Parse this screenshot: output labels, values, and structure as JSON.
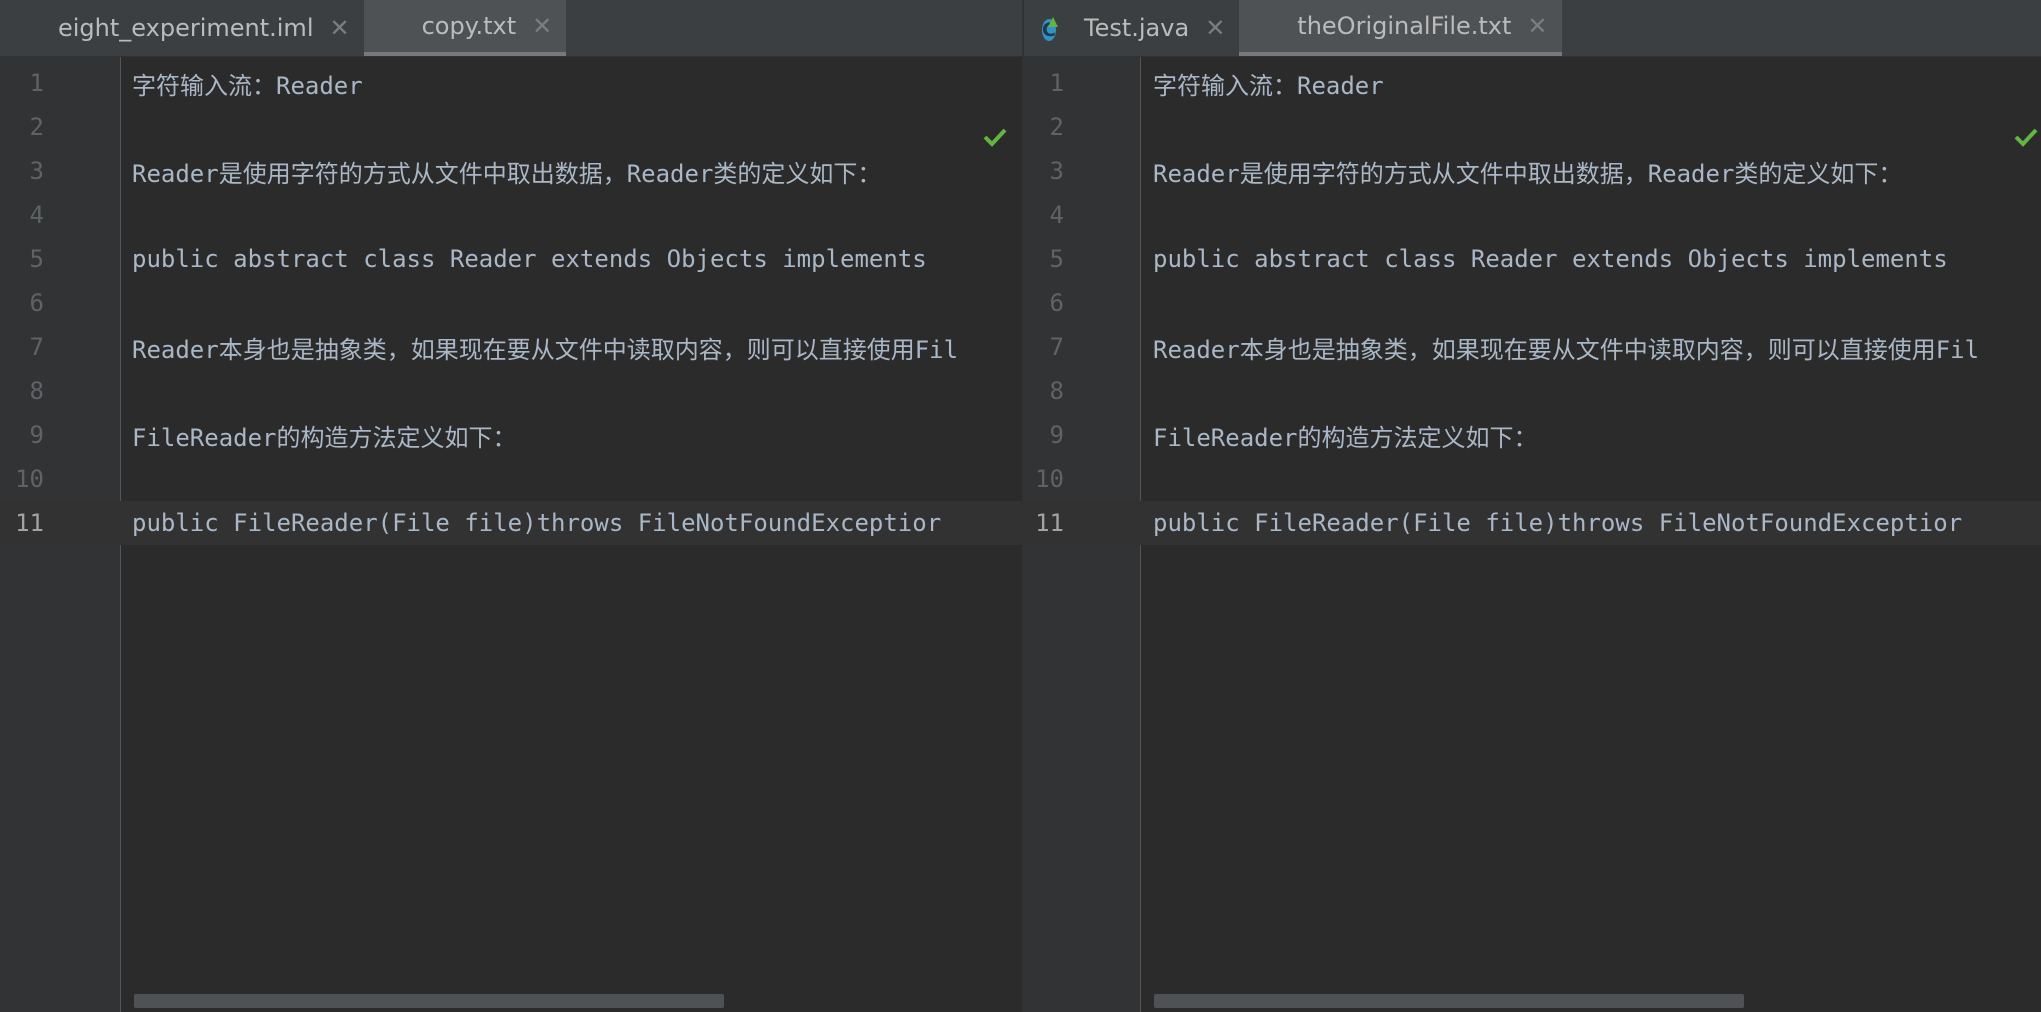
{
  "left_pane": {
    "tabs": [
      {
        "label": "eight_experiment.iml",
        "icon": "module-file-icon",
        "active": false
      },
      {
        "label": "copy.txt",
        "icon": "text-file-icon",
        "active": true
      }
    ],
    "lines": [
      {
        "number": "1",
        "text": "字符输入流：Reader"
      },
      {
        "number": "2",
        "text": ""
      },
      {
        "number": "3",
        "text": "Reader是使用字符的方式从文件中取出数据，Reader类的定义如下："
      },
      {
        "number": "4",
        "text": ""
      },
      {
        "number": "5",
        "text": "public abstract class Reader extends Objects implements"
      },
      {
        "number": "6",
        "text": ""
      },
      {
        "number": "7",
        "text": "Reader本身也是抽象类，如果现在要从文件中读取内容，则可以直接使用Fil"
      },
      {
        "number": "8",
        "text": ""
      },
      {
        "number": "9",
        "text": "FileReader的构造方法定义如下："
      },
      {
        "number": "10",
        "text": ""
      },
      {
        "number": "11",
        "text": "public FileReader(File file)throws FileNotFoundExceptior"
      }
    ],
    "current_line": "11",
    "inspection_status": "ok-checkmark",
    "scroll_fraction": 0.6
  },
  "right_pane": {
    "tabs": [
      {
        "label": "Test.java",
        "icon": "java-class-icon",
        "active": false
      },
      {
        "label": "theOriginalFile.txt",
        "icon": "text-file-icon",
        "active": true
      }
    ],
    "lines": [
      {
        "number": "1",
        "text": "字符输入流：Reader"
      },
      {
        "number": "2",
        "text": ""
      },
      {
        "number": "3",
        "text": "Reader是使用字符的方式从文件中取出数据，Reader类的定义如下："
      },
      {
        "number": "4",
        "text": ""
      },
      {
        "number": "5",
        "text": "public abstract class Reader extends Objects implements"
      },
      {
        "number": "6",
        "text": ""
      },
      {
        "number": "7",
        "text": "Reader本身也是抽象类，如果现在要从文件中读取内容，则可以直接使用Fil"
      },
      {
        "number": "8",
        "text": ""
      },
      {
        "number": "9",
        "text": "FileReader的构造方法定义如下："
      },
      {
        "number": "10",
        "text": ""
      },
      {
        "number": "11",
        "text": "public FileReader(File file)throws FileNotFoundExceptior"
      }
    ],
    "current_line": "11",
    "inspection_status": "ok-checkmark",
    "scroll_fraction": 0.6
  },
  "colors": {
    "editor_background": "#2b2b2b",
    "gutter_background": "#313335",
    "tabbar_background": "#3c3f41",
    "active_tab_background": "#4e5254",
    "text": "#a9b7c6",
    "line_number": "#606366",
    "check_green": "#62b543"
  }
}
